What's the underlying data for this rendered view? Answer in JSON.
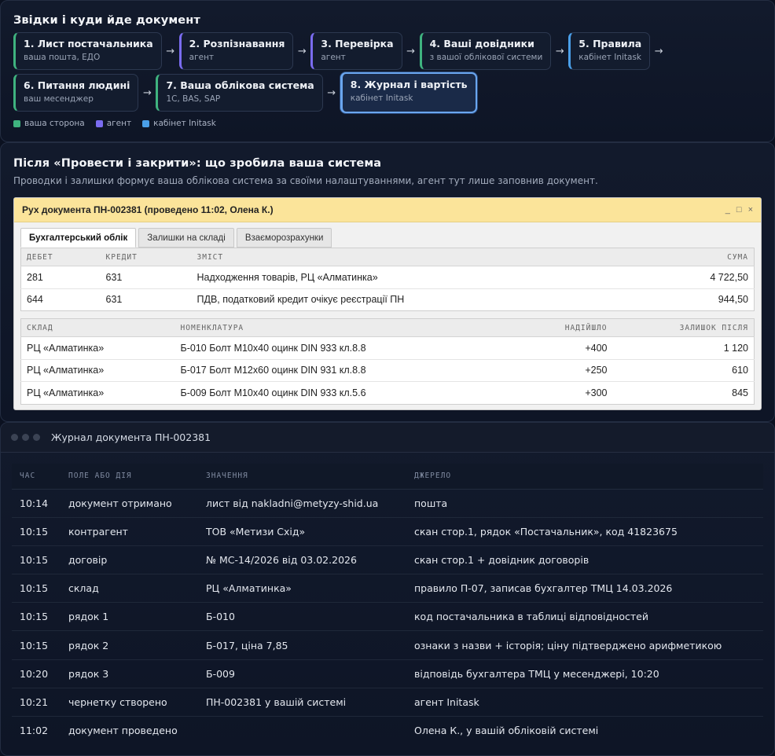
{
  "flow": {
    "title": "Звідки і куди йде документ",
    "steps": [
      {
        "title": "1. Лист постачальника",
        "sub": "ваша пошта, ЕДО"
      },
      {
        "title": "2. Розпізнавання",
        "sub": "агент"
      },
      {
        "title": "3. Перевірка",
        "sub": "агент"
      },
      {
        "title": "4. Ваші довідники",
        "sub": "з вашої облікової системи"
      },
      {
        "title": "5. Правила",
        "sub": "кабінет Initask"
      },
      {
        "title": "6. Питання людині",
        "sub": "ваш месенджер"
      },
      {
        "title": "7. Ваша облікова система",
        "sub": "1С, BAS, SAP"
      },
      {
        "title": "8. Журнал і вартість",
        "sub": "кабінет Initask"
      }
    ],
    "arrow": "→",
    "legend": [
      {
        "label": "ваша сторона",
        "color": "#3fb37f"
      },
      {
        "label": "агент",
        "color": "#7a6cf0"
      },
      {
        "label": "кабінет Initask",
        "color": "#4a9fe8"
      }
    ]
  },
  "after": {
    "title": "Після «Провести і закрити»: що зробила ваша система",
    "desc": "Проводки і залишки формує ваша облікова система за своїми налаштуваннями, агент тут лише заповнив документ.",
    "window": {
      "title": "Рух документа ПН-002381 (проведено 11:02, Олена К.)",
      "controls": [
        "_",
        "□",
        "×"
      ],
      "tabs": [
        "Бухгалтерський облік",
        "Залишки на складі",
        "Взаєморозрахунки"
      ],
      "entries": {
        "headers": [
          "ДЕБЕТ",
          "КРЕДИТ",
          "ЗМІСТ",
          "СУМА"
        ],
        "rows": [
          {
            "debit": "281",
            "credit": "631",
            "content": "Надходження товарів, РЦ «Алматинка»",
            "sum": "4 722,50"
          },
          {
            "debit": "644",
            "credit": "631",
            "content": "ПДВ, податковий кредит очікує реєстрації ПН",
            "sum": "944,50"
          }
        ]
      },
      "stock": {
        "headers": [
          "СКЛАД",
          "НОМЕНКЛАТУРА",
          "НАДІЙШЛО",
          "ЗАЛИШОК ПІСЛЯ"
        ],
        "rows": [
          {
            "warehouse": "РЦ «Алматинка»",
            "item": "Б-010 Болт М10х40 оцинк DIN 933 кл.8.8",
            "in": "+400",
            "after": "1 120"
          },
          {
            "warehouse": "РЦ «Алматинка»",
            "item": "Б-017 Болт М12х60 оцинк DIN 931 кл.8.8",
            "in": "+250",
            "after": "610"
          },
          {
            "warehouse": "РЦ «Алматинка»",
            "item": "Б-009 Болт М10х40 оцинк DIN 933 кл.5.6",
            "in": "+300",
            "after": "845"
          }
        ]
      }
    }
  },
  "journal": {
    "title": "Журнал документа ПН-002381",
    "headers": [
      "ЧАС",
      "ПОЛЕ АБО ДІЯ",
      "ЗНАЧЕННЯ",
      "ДЖЕРЕЛО"
    ],
    "rows": [
      {
        "time": "10:14",
        "field": "документ отримано",
        "value": "лист від nakladni@metyzy-shid.ua",
        "source": "пошта"
      },
      {
        "time": "10:15",
        "field": "контрагент",
        "value": "ТОВ «Метизи Схід»",
        "source": "скан стор.1, рядок «Постачальник», код 41823675"
      },
      {
        "time": "10:15",
        "field": "договір",
        "value": "№ МС-14/2026 від 03.02.2026",
        "source": "скан стор.1 + довідник договорів"
      },
      {
        "time": "10:15",
        "field": "склад",
        "value": "РЦ «Алматинка»",
        "source": "правило П-07, записав бухгалтер ТМЦ 14.03.2026"
      },
      {
        "time": "10:15",
        "field": "рядок 1",
        "value": "Б-010",
        "source": "код постачальника в таблиці відповідностей"
      },
      {
        "time": "10:15",
        "field": "рядок 2",
        "value": "Б-017, ціна 7,85",
        "source": "ознаки з назви + історія; ціну підтверджено арифметикою"
      },
      {
        "time": "10:20",
        "field": "рядок 3",
        "value": "Б-009",
        "source": "відповідь бухгалтера ТМЦ у месенджері, 10:20"
      },
      {
        "time": "10:21",
        "field": "чернетку створено",
        "value": "ПН-002381 у вашій системі",
        "source": "агент Initask"
      },
      {
        "time": "11:02",
        "field": "документ проведено",
        "value": "",
        "source": "Олена К., у вашій обліковій системі"
      }
    ]
  }
}
